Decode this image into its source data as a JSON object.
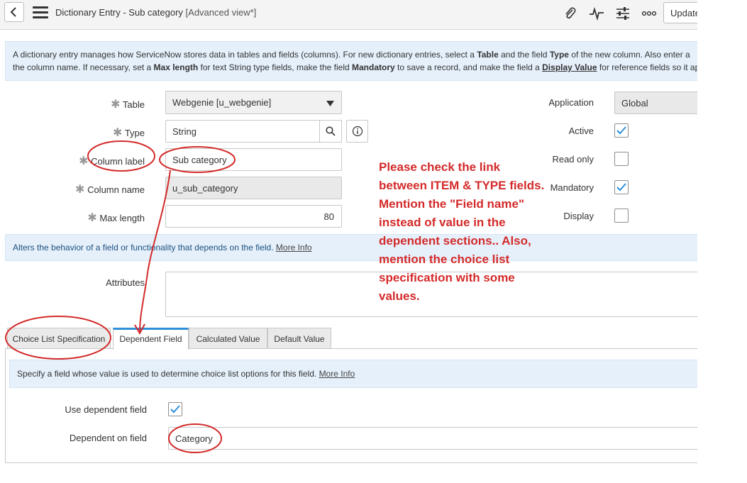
{
  "header": {
    "title": "Dictionary Entry - Sub category",
    "view": "[Advanced view*]",
    "update_label": "Update",
    "icons": [
      "back-icon",
      "menu-icon",
      "paperclip-icon",
      "activity-icon",
      "sliders-icon",
      "more-icon"
    ]
  },
  "info_banner": {
    "line1_a": "A dictionary entry manages how ServiceNow stores data in tables and fields (columns). For new dictionary entries, select a ",
    "line1_b": "Table",
    "line1_c": " and the field ",
    "line1_d": "Type",
    "line1_e": " of the new column. Also enter a",
    "line2_a": "the column name. If necessary, set a ",
    "line2_b": "Max length",
    "line2_c": " for text String type fields, make the field ",
    "line2_d": "Mandatory",
    "line2_e": " to save a record, and make the field a ",
    "line2_f": "Display Value",
    "line2_g": " for reference fields so it app"
  },
  "form": {
    "table_label": "Table",
    "table_value": "Webgenie [u_webgenie]",
    "type_label": "Type",
    "type_value": "String",
    "column_label_label": "Column label",
    "column_label_value": "Sub category",
    "column_name_label": "Column name",
    "column_name_value": "u_sub_category",
    "max_length_label": "Max length",
    "max_length_value": "80",
    "application_label": "Application",
    "application_value": "Global",
    "active_label": "Active",
    "active_checked": true,
    "read_only_label": "Read only",
    "read_only_checked": false,
    "mandatory_label": "Mandatory",
    "mandatory_checked": true,
    "display_label": "Display",
    "display_checked": false,
    "attributes_label": "Attributes",
    "attributes_value": ""
  },
  "dependent_banner": {
    "text": "Alters the behavior of a field or functionality that depends on the field. ",
    "link": "More Info"
  },
  "tabs": [
    {
      "label": "Choice List Specification",
      "active": false
    },
    {
      "label": "Dependent Field",
      "active": true
    },
    {
      "label": "Calculated Value",
      "active": false
    },
    {
      "label": "Default Value",
      "active": false
    }
  ],
  "dependent_panel": {
    "banner_text": "Specify a field whose value is used to determine choice list options for this field. ",
    "banner_link": "More Info",
    "use_dependent_label": "Use dependent field",
    "use_dependent_checked": true,
    "dependent_on_label": "Dependent on field",
    "dependent_on_value": "Category"
  },
  "annotation": {
    "text": "Please check the link between ITEM & TYPE fields. Mention the \"Field name\" instead of value in the dependent sections.. Also, mention the choice list specification with some values.",
    "color": "#d42a2a"
  },
  "colors": {
    "accent": "#2f8fd8",
    "banner_bg": "#e5f0fb",
    "annotation": "#d42a2a"
  }
}
